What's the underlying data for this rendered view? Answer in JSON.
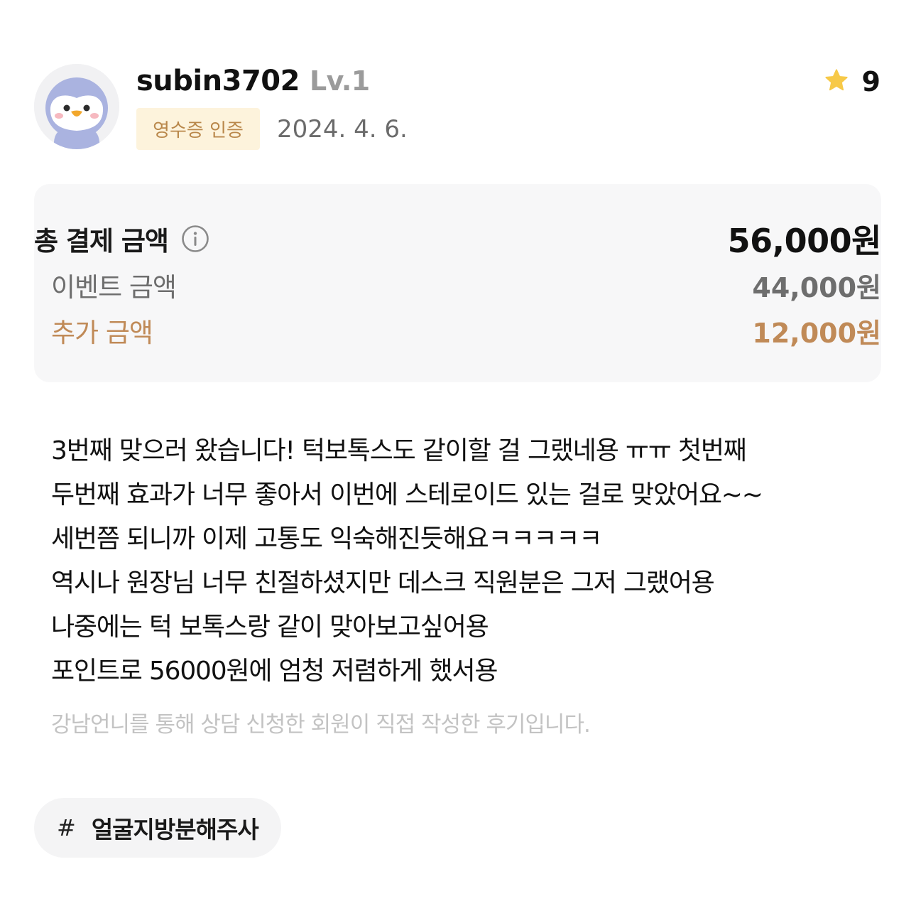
{
  "review": {
    "author": {
      "username": "subin3702",
      "level": "Lv.1",
      "avatar_icon": "penguin-avatar-icon"
    },
    "badge_label": "영수증 인증",
    "date": "2024. 4. 6.",
    "rating": {
      "icon": "star-icon",
      "score": "9"
    },
    "payment": {
      "total_label": "총 결제 금액",
      "total_value": "56,000원",
      "info_icon": "info-icon",
      "event_label": "이벤트 금액",
      "event_value": "44,000원",
      "extra_label": "추가 금액",
      "extra_value": "12,000원"
    },
    "body_lines": [
      "3번째 맞으러 왔습니다! 턱보톡스도 같이할 걸 그랬네용 ㅠㅠ 첫번째",
      "두번째 효과가 너무 좋아서 이번에 스테로이드 있는 걸로 맞았어요~~",
      "세번쯤 되니까 이제 고통도 익숙해진듯해요ㅋㅋㅋㅋㅋ",
      "역시나 원장님 너무 친절하셨지만 데스크 직원분은 그저 그랬어용",
      "나중에는 턱 보톡스랑 같이 맞아보고싶어용",
      "포인트로 56000원에 엄청 저렴하게 했서용"
    ],
    "disclaimer": "강남언니를 통해 상담 신청한 회원이 직접 작성한 후기입니다.",
    "tag": {
      "hash": "#",
      "label": "얼굴지방분해주사"
    },
    "colors": {
      "badge_bg": "#fdf3dc",
      "badge_text": "#b9874a",
      "extra_accent": "#c08a57",
      "star": "#f7c948",
      "panel_bg": "#f7f7f8"
    }
  }
}
